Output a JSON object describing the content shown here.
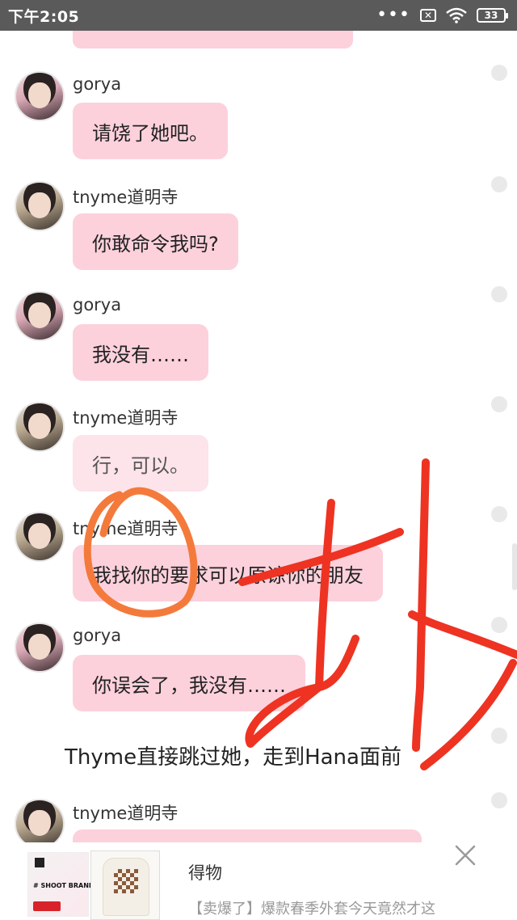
{
  "status_bar": {
    "time": "下午2:05",
    "dots": "•••",
    "battery": "33"
  },
  "chat": {
    "messages": [
      {
        "sender": "gorya",
        "text": "请饶了她吧。"
      },
      {
        "sender": "tnyme道明寺",
        "text": "你敢命令我吗?"
      },
      {
        "sender": "gorya",
        "text": "我没有……"
      },
      {
        "sender": "tnyme道明寺",
        "text": "行，可以。"
      },
      {
        "sender": "tnyme道明寺",
        "text": "我找你的要求可以原谅你的朋友"
      },
      {
        "sender": "gorya",
        "text": "你误会了，我没有……"
      }
    ],
    "narration": "Thyme直接跳过她，走到Hana面前",
    "last_sender": "tnyme道明寺"
  },
  "ad": {
    "brand_tag": "# SHOOT BRAND #",
    "title": "得物",
    "description": "【卖爆了】爆款春季外套今天竟然才这"
  },
  "colors": {
    "bubble": "#fcd1dc",
    "bubble_light": "#fde3ea",
    "status_bar": "#5a5a5a",
    "marker_orange": "#f47a3c",
    "marker_red": "#ee3322"
  }
}
